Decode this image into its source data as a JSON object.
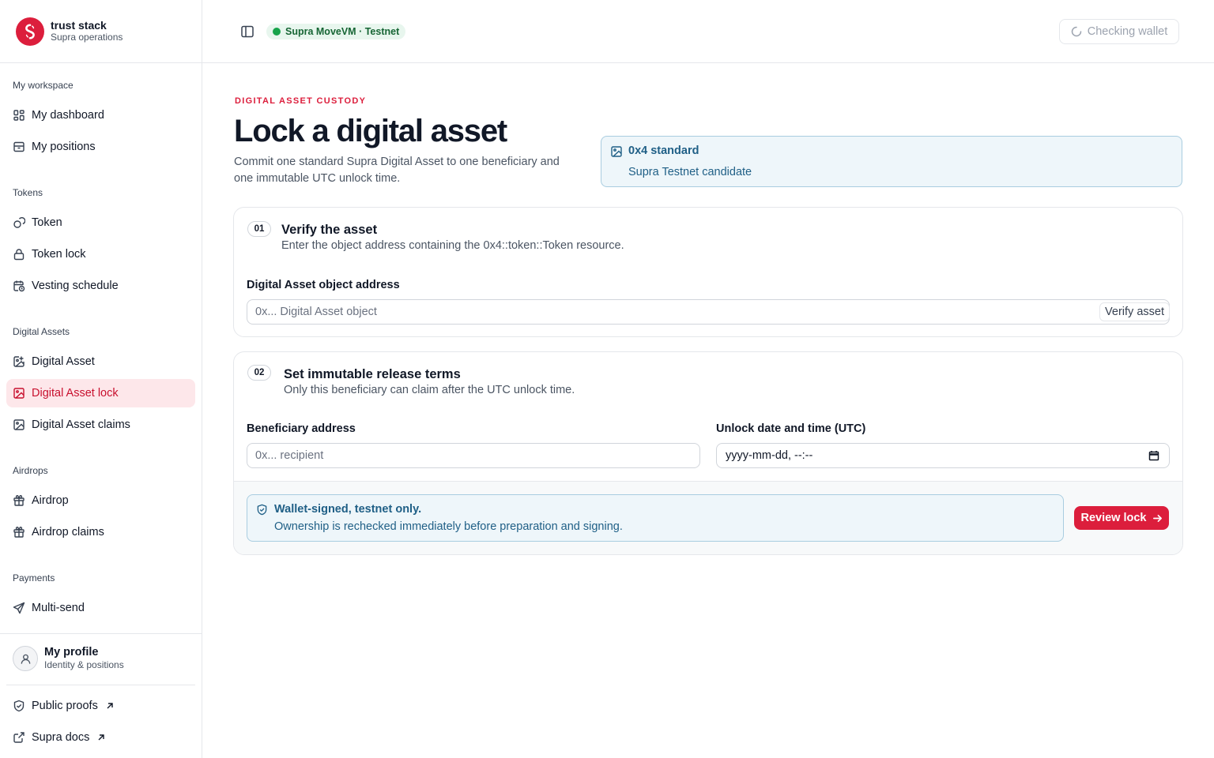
{
  "brand": {
    "title": "trust stack",
    "subtitle": "Supra operations",
    "color": "#dc1e3c"
  },
  "sidebar": {
    "groups": [
      {
        "label": "My workspace",
        "items": [
          {
            "label": "My dashboard",
            "icon": "dashboard-icon"
          },
          {
            "label": "My positions",
            "icon": "archive-icon"
          }
        ]
      },
      {
        "label": "Tokens",
        "items": [
          {
            "label": "Token",
            "icon": "coins-icon"
          },
          {
            "label": "Token lock",
            "icon": "lock-icon"
          },
          {
            "label": "Vesting schedule",
            "icon": "calendar-clock-icon"
          }
        ]
      },
      {
        "label": "Digital Assets",
        "items": [
          {
            "label": "Digital Asset",
            "icon": "image-plus-icon"
          },
          {
            "label": "Digital Asset lock",
            "icon": "image-icon",
            "active": true
          },
          {
            "label": "Digital Asset claims",
            "icon": "image-icon"
          }
        ]
      },
      {
        "label": "Airdrops",
        "items": [
          {
            "label": "Airdrop",
            "icon": "gift-icon"
          },
          {
            "label": "Airdrop claims",
            "icon": "gift-icon"
          }
        ]
      },
      {
        "label": "Payments",
        "items": [
          {
            "label": "Multi-send",
            "icon": "send-icon"
          }
        ]
      }
    ],
    "profile": {
      "name": "My profile",
      "subtitle": "Identity & positions"
    },
    "footer_links": [
      {
        "label": "Public proofs",
        "icon": "shield-icon"
      },
      {
        "label": "Supra docs",
        "icon": "external-link-icon"
      }
    ]
  },
  "header": {
    "network_badge": "Supra MoveVM · Testnet",
    "wallet_button": "Checking wallet"
  },
  "main": {
    "eyebrow": "DIGITAL ASSET CUSTODY",
    "title": "Lock a digital asset",
    "description": "Commit one standard Supra Digital Asset to one beneficiary and one immutable UTC unlock time.",
    "standard_card": {
      "title": "0x4 standard",
      "subtitle": "Supra Testnet candidate"
    },
    "step1": {
      "number": "01",
      "title": "Verify the asset",
      "subtitle": "Enter the object address containing the 0x4::token::Token resource.",
      "field_label": "Digital Asset object address",
      "placeholder": "0x... Digital Asset object",
      "verify_button": "Verify asset"
    },
    "step2": {
      "number": "02",
      "title": "Set immutable release terms",
      "subtitle": "Only this beneficiary can claim after the UTC unlock time.",
      "beneficiary_label": "Beneficiary address",
      "beneficiary_placeholder": "0x... recipient",
      "unlock_label": "Unlock date and time (UTC)",
      "unlock_placeholder": "yyyy-mm-dd, --:--",
      "notice_title": "Wallet-signed, testnet only.",
      "notice_text": "Ownership is rechecked immediately before preparation and signing.",
      "review_button": "Review lock"
    }
  }
}
